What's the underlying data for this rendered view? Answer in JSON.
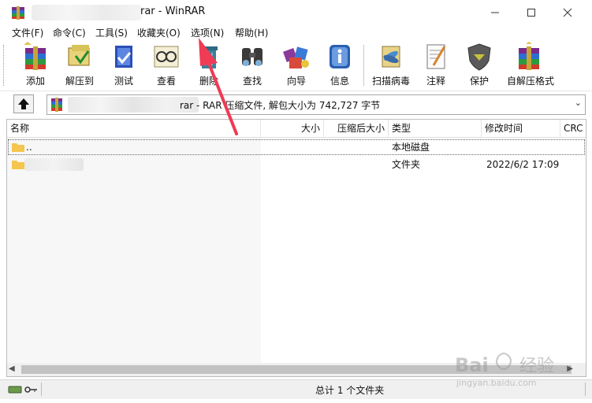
{
  "window": {
    "title": "rar - WinRAR",
    "minimize_icon": "minimize-icon",
    "maximize_icon": "maximize-icon",
    "close_icon": "close-icon"
  },
  "menu": [
    "文件(F)",
    "命令(C)",
    "工具(S)",
    "收藏夹(O)",
    "选项(N)",
    "帮助(H)"
  ],
  "toolbar": [
    {
      "label": "添加",
      "icon": "add-archive-icon"
    },
    {
      "label": "解压到",
      "icon": "extract-to-icon"
    },
    {
      "label": "测试",
      "icon": "test-icon"
    },
    {
      "label": "查看",
      "icon": "view-icon"
    },
    {
      "label": "删除",
      "icon": "delete-icon"
    },
    {
      "label": "查找",
      "icon": "find-icon"
    },
    {
      "label": "向导",
      "icon": "wizard-icon"
    },
    {
      "label": "信息",
      "icon": "info-icon"
    },
    {
      "label": "扫描病毒",
      "icon": "virus-scan-icon"
    },
    {
      "label": "注释",
      "icon": "comment-icon"
    },
    {
      "label": "保护",
      "icon": "protect-icon"
    },
    {
      "label": "自解压格式",
      "icon": "sfx-icon"
    }
  ],
  "address": {
    "text": "rar - RAR 压缩文件, 解包大小为 742,727 字节"
  },
  "columns": [
    "名称",
    "大小",
    "压缩后大小",
    "类型",
    "修改时间",
    "CRC"
  ],
  "rows": [
    {
      "name": "..",
      "size": "",
      "packed": "",
      "type": "本地磁盘",
      "modified": ""
    },
    {
      "name": "",
      "size": "",
      "packed": "",
      "type": "文件夹",
      "modified": "2022/6/2 17:09"
    }
  ],
  "status": {
    "text": "总计 1 个文件夹"
  },
  "watermark": {
    "brand": "Bai",
    "brand2": "经验",
    "url": "jingyan.baidu.com"
  },
  "colors": {
    "annotation_arrow": "#ef3b55",
    "folder": "#f5c64e"
  }
}
